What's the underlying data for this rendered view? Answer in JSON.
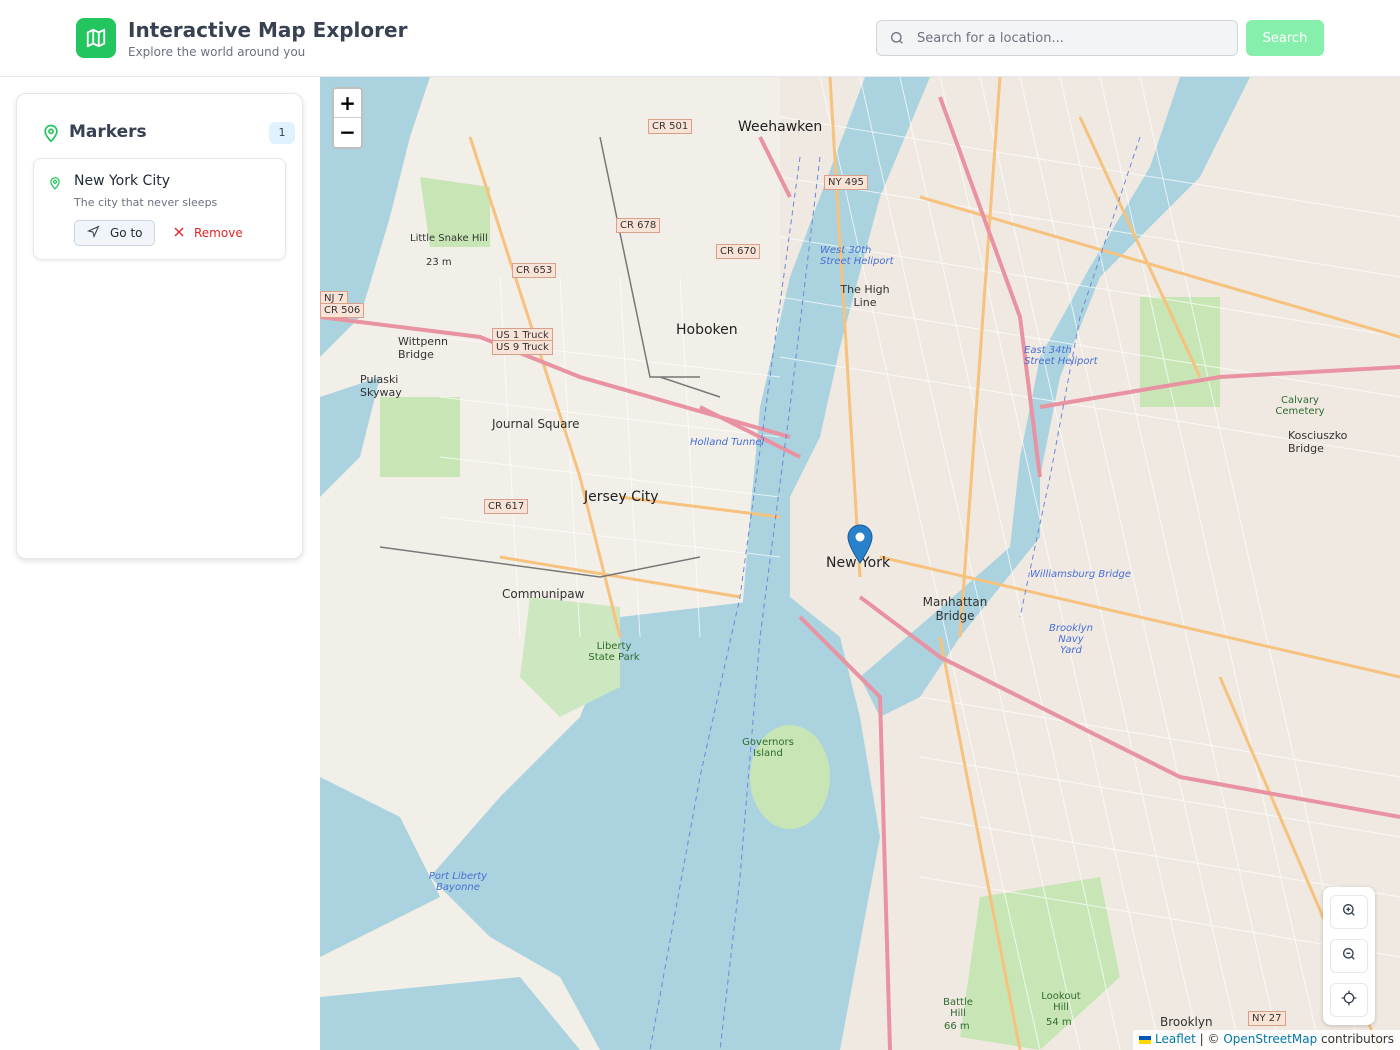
{
  "header": {
    "title": "Interactive Map Explorer",
    "subtitle": "Explore the world around you",
    "search_placeholder": "Search for a location...",
    "search_button": "Search",
    "logo_icon": "map-icon",
    "accent_color": "#22c55e"
  },
  "sidebar": {
    "title": "Markers",
    "count": "1",
    "markers": [
      {
        "title": "New York City",
        "description": "The city that never sleeps",
        "goto_label": "Go to",
        "remove_label": "Remove"
      }
    ]
  },
  "map": {
    "zoom_in": "+",
    "zoom_out": "−",
    "attribution": {
      "leaflet": "Leaflet",
      "separator": " | © ",
      "osm": "OpenStreetMap",
      "suffix": " contributors"
    },
    "labels": {
      "new_york": "New York",
      "manhattan_bridge": "Manhattan Bridge",
      "weehawken": "Weehawken",
      "hoboken": "Hoboken",
      "jersey_city": "Jersey City",
      "journal_square": "Journal Square",
      "communipaw": "Communipaw",
      "brooklyn": "Brooklyn",
      "kosciuszko_bridge": "Kosciuszko Bridge",
      "governors_island": "Governors Island",
      "liberty_state_park": "Liberty State Park",
      "the_high_line": "The High Line",
      "holland_tunnel": "Holland Tunnel",
      "williamsburg_bridge": "Williamsburg Bridge",
      "pulaski_skyway": "Pulaski Skyway",
      "wittpenn_bridge": "Wittpenn Bridge",
      "little_snake_hill": "Little Snake Hill",
      "hill_height": "23 m",
      "cr501": "CR 501",
      "ny495": "NY 495",
      "cr678": "CR 678",
      "cr670": "CR 670",
      "cr653": "CR 653",
      "cr617": "CR 617",
      "us1": "US 1 Truck",
      "us9": "US 9 Truck",
      "nj7": "NJ 7",
      "cr506": "CR 506",
      "ny27": "NY 27",
      "port_liberty": "Port Liberty Bayonne",
      "lookout_hill": "Lookout Hill",
      "lookout_height": "54 m",
      "battle_hill": "Battle Hill",
      "battle_height": "66 m",
      "brooklyn_navy_yard": "Brooklyn Navy Yard",
      "calvary_cemetery": "Calvary Cemetery",
      "west_30th_heliport": "West 30th Street Heliport",
      "east_34th_heliport": "East 34th Street Heliport"
    }
  }
}
